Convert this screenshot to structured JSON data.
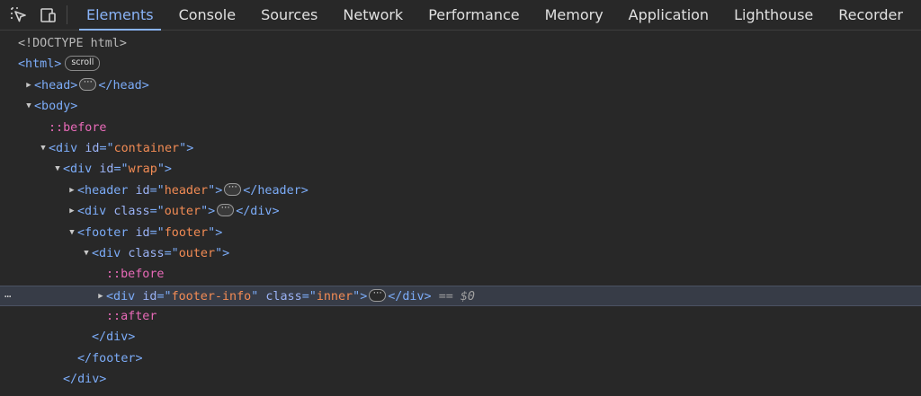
{
  "tabs": [
    {
      "label": "Elements",
      "active": true
    },
    {
      "label": "Console",
      "active": false
    },
    {
      "label": "Sources",
      "active": false
    },
    {
      "label": "Network",
      "active": false
    },
    {
      "label": "Performance",
      "active": false
    },
    {
      "label": "Memory",
      "active": false
    },
    {
      "label": "Application",
      "active": false
    },
    {
      "label": "Lighthouse",
      "active": false
    },
    {
      "label": "Recorder",
      "active": false
    }
  ],
  "icons": {
    "inspect": "inspect-element-icon",
    "device": "device-toolbar-icon"
  },
  "badges": {
    "scroll": "scroll"
  },
  "tree": {
    "doctype": "<!DOCTYPE html>",
    "html_open": "<html>",
    "head_open": "<head>",
    "head_close": "</head>",
    "body_open": "<body>",
    "before": "::before",
    "div_open": "<div",
    "div_close_bracket": ">",
    "id_attr": "id",
    "class_attr": "class",
    "eq_quote": "=\"",
    "quote": "\"",
    "container": "container",
    "wrap": "wrap",
    "header_open": "<header",
    "header_val": "header",
    "header_close": "</header>",
    "outer": "outer",
    "div_end": "</div>",
    "footer_open": "<footer",
    "footer_val": "footer",
    "footer_info": "footer-info",
    "inner": "inner",
    "selected_suffix": "== $0",
    "after": "::after",
    "footer_close": "</footer>",
    "gutter": "⋯",
    "ellipsis": "⋯"
  }
}
